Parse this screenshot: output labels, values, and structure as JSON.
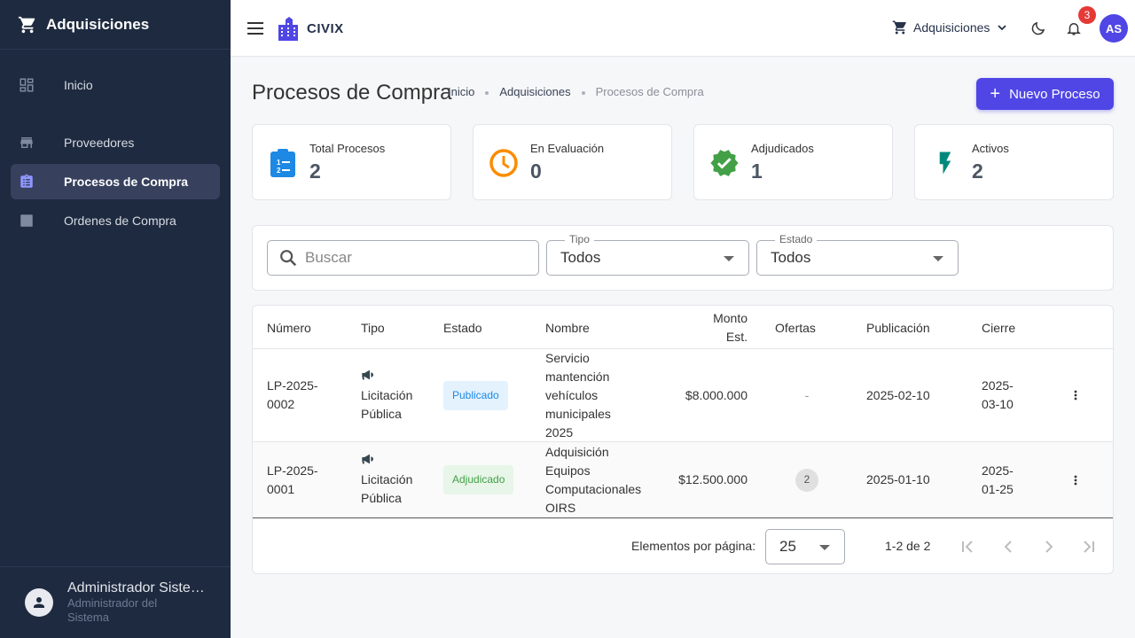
{
  "sidebar": {
    "title": "Adquisiciones",
    "items": [
      {
        "label": "Inicio"
      },
      {
        "label": "Proveedores"
      },
      {
        "label": "Procesos de Compra"
      },
      {
        "label": "Ordenes de Compra"
      }
    ],
    "user": {
      "name": "Administrador Sistema",
      "role": "Administrador del Sistema"
    }
  },
  "topbar": {
    "logo_text": "CIVIX",
    "module": "Adquisiciones",
    "notification_count": "3",
    "avatar_initials": "AS"
  },
  "page": {
    "title": "Procesos de Compra",
    "breadcrumb": [
      "Inicio",
      "Adquisiciones",
      "Procesos de Compra"
    ],
    "new_button": "Nuevo Proceso"
  },
  "stats": [
    {
      "label": "Total Procesos",
      "value": "2"
    },
    {
      "label": "En Evaluación",
      "value": "0"
    },
    {
      "label": "Adjudicados",
      "value": "1"
    },
    {
      "label": "Activos",
      "value": "2"
    }
  ],
  "filters": {
    "search_placeholder": "Buscar",
    "tipo_label": "Tipo",
    "tipo_value": "Todos",
    "estado_label": "Estado",
    "estado_value": "Todos"
  },
  "table": {
    "headers": {
      "numero": "Número",
      "tipo": "Tipo",
      "estado": "Estado",
      "nombre": "Nombre",
      "monto_1": "Monto",
      "monto_2": "Est.",
      "ofertas": "Ofertas",
      "publicacion": "Publicación",
      "cierre": "Cierre"
    },
    "rows": [
      {
        "numero_1": "LP-2025-",
        "numero_2": "0002",
        "tipo_1": "Licitación",
        "tipo_2": "Pública",
        "estado": "Publicado",
        "nombre": [
          "Servicio",
          "mantención",
          "vehículos",
          "municipales",
          "2025"
        ],
        "monto": "$8.000.000",
        "ofertas": "-",
        "publicacion": "2025-02-10",
        "cierre_1": "2025-",
        "cierre_2": "03-10"
      },
      {
        "numero_1": "LP-2025-",
        "numero_2": "0001",
        "tipo_1": "Licitación",
        "tipo_2": "Pública",
        "estado": "Adjudicado",
        "nombre": [
          "Adquisición",
          "Equipos",
          "Computacionales",
          "OIRS"
        ],
        "monto": "$12.500.000",
        "ofertas": "2",
        "publicacion": "2025-01-10",
        "cierre_1": "2025-",
        "cierre_2": "01-25"
      }
    ]
  },
  "pagination": {
    "per_page_label": "Elementos por página:",
    "per_page_value": "25",
    "range": "1-2 de 2"
  },
  "colors": {
    "primary": "#4f46e5",
    "sidebar_bg": "#1e2a3f",
    "stat_blue": "#1e88e5",
    "stat_orange": "#fb8c00",
    "stat_green": "#43a047",
    "stat_teal": "#00897b"
  }
}
